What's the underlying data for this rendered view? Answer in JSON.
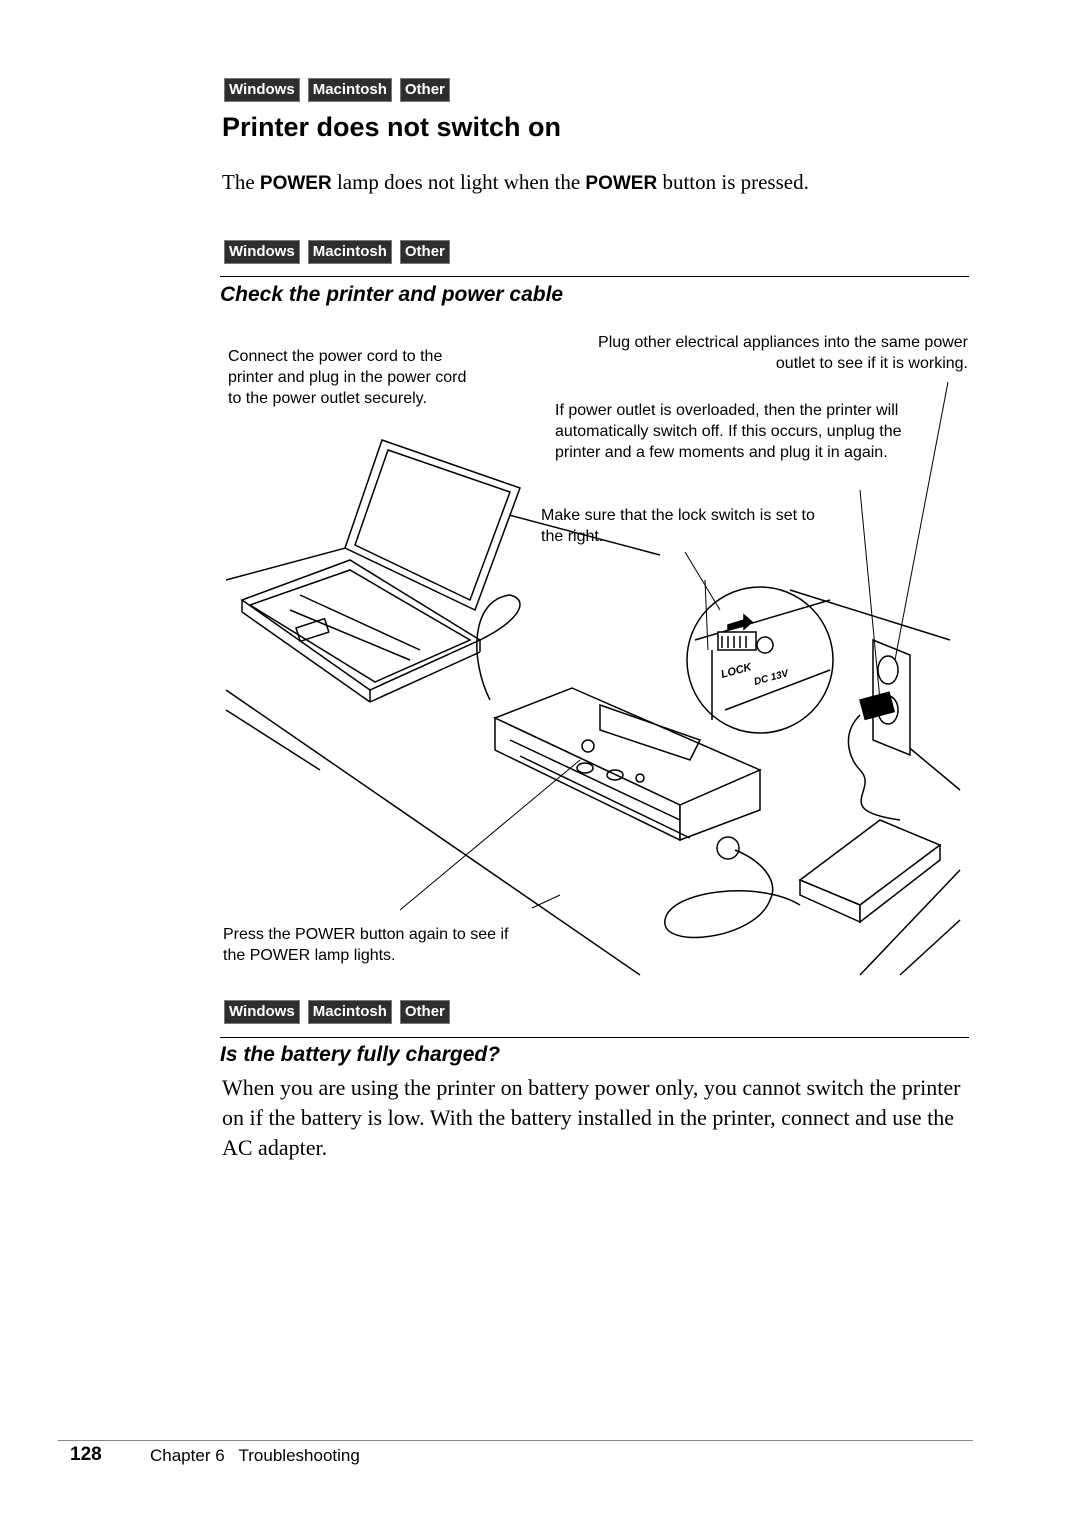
{
  "platform_tags": [
    "Windows",
    "Macintosh",
    "Other"
  ],
  "title": "Printer does not switch on",
  "lead": {
    "part1": "The ",
    "kw1": "POWER",
    "part2": " lamp does not light when the ",
    "kw2": "POWER",
    "part3": " button is pressed."
  },
  "section1": {
    "heading": "Check the printer and power cable",
    "captions": {
      "connect": "Connect the power cord to the printer and plug in the power cord to the power outlet securely.",
      "plug_other": "Plug other electrical appliances into the same power outlet to see if it is working.",
      "overload": "If power outlet is overloaded, then the printer will automatically switch off. If this occurs, unplug the printer and a few moments and plug it in again.",
      "lock": "Make sure that the lock switch is set to the right.",
      "press": "Press the POWER button again to see if the POWER lamp lights."
    },
    "illustration_labels": {
      "lock": "LOCK",
      "dc": "DC 13V"
    }
  },
  "section2": {
    "heading": "Is the battery fully charged?",
    "body": "When you are using the printer on battery power only, you cannot switch the printer on if the battery is low. With the battery installed in the printer, connect and use the AC adapter."
  },
  "footer": {
    "page_number": "128",
    "chapter": "Chapter 6   Troubleshooting"
  }
}
